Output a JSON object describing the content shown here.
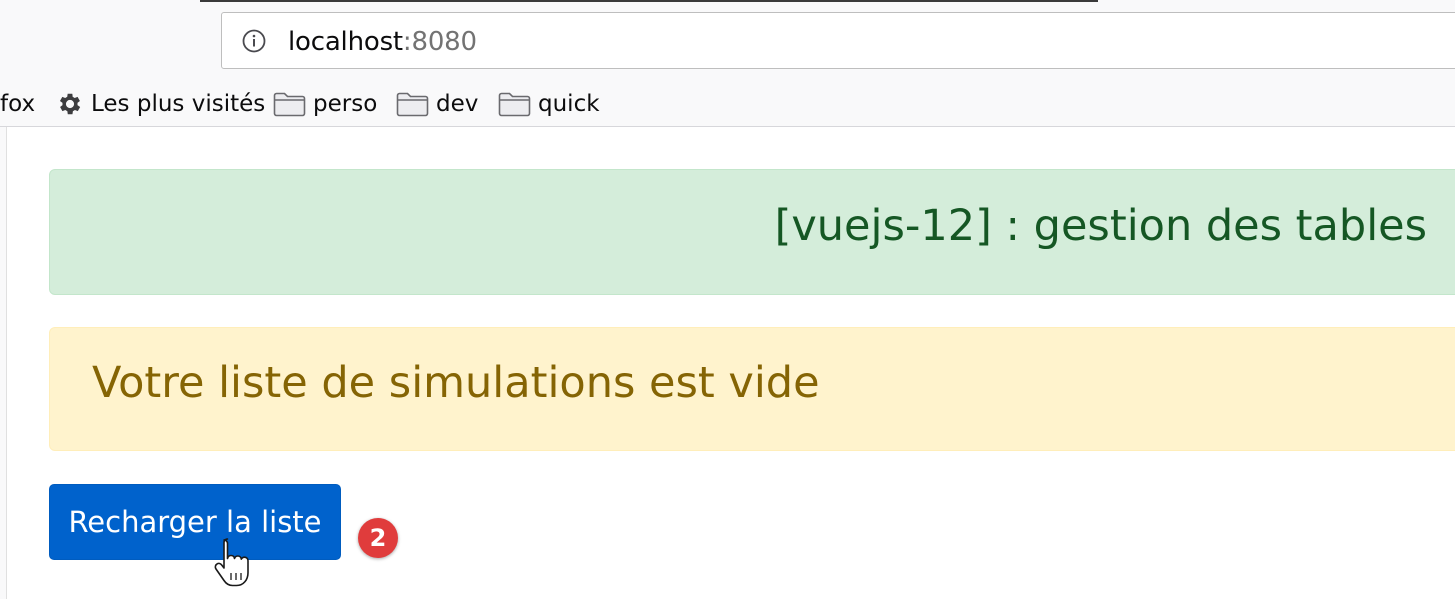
{
  "browser": {
    "url_host": "localhost",
    "url_port": ":8080",
    "bookmarks": [
      {
        "label": "fox",
        "icon": "none"
      },
      {
        "label": "Les plus visités",
        "icon": "gear-icon"
      },
      {
        "label": "perso",
        "icon": "folder-icon"
      },
      {
        "label": "dev",
        "icon": "folder-icon"
      },
      {
        "label": "quick",
        "icon": "folder-icon"
      }
    ]
  },
  "page": {
    "title": "[vuejs-12] : gestion des tables",
    "empty_message": "Votre liste de simulations est vide",
    "reload_button": "Recharger la liste",
    "step_badge": "2"
  },
  "colors": {
    "success_bg": "#d4edda",
    "success_text": "#155724",
    "warning_bg": "#fff3cd",
    "warning_text": "#856404",
    "primary_button": "#0062cc",
    "badge": "#e03c3c"
  }
}
